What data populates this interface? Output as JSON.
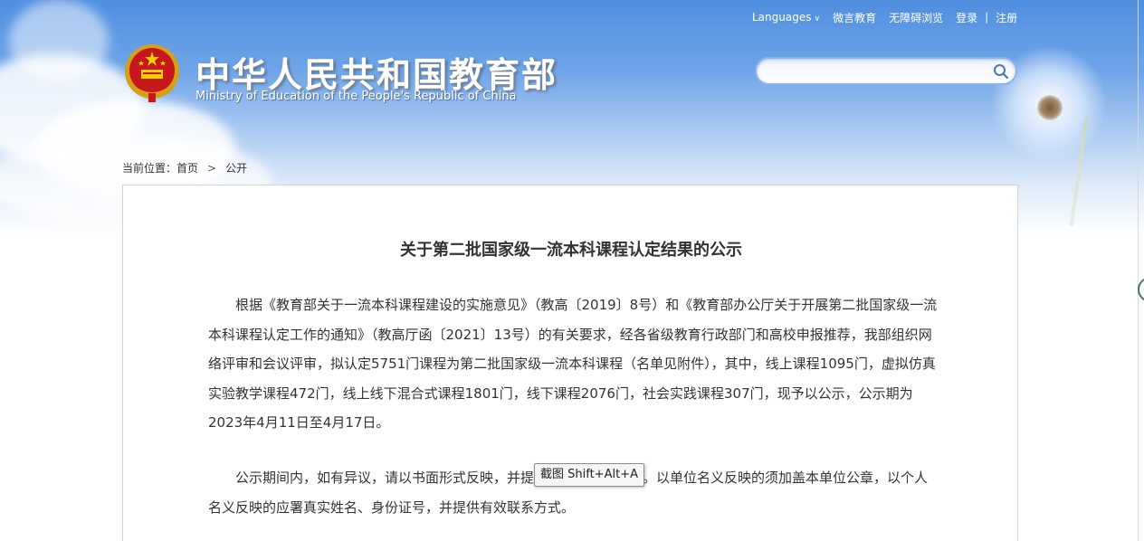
{
  "header": {
    "title_cn": "中华人民共和国教育部",
    "title_en": "Ministry of Education of the People's Republic of China",
    "links": {
      "languages": "Languages",
      "weiyan": "微言教育",
      "accessible": "无障碍浏览",
      "login": "登录",
      "separator": "|",
      "register": "注册"
    },
    "search": {
      "placeholder": "",
      "value": ""
    }
  },
  "breadcrumb": {
    "prefix": "当前位置：",
    "home": "首页",
    "separator": ">",
    "current": "公开"
  },
  "article": {
    "title": "关于第二批国家级一流本科课程认定结果的公示",
    "paragraph1": "根据《教育部关于一流本科课程建设的实施意见》（教高〔2019〕8号）和《教育部办公厅关于开展第二批国家级一流本科课程认定工作的通知》（教高厅函〔2021〕13号）的有关要求，经各省级教育行政部门和高校申报推荐，我部组织网络评审和会议评审，拟认定5751门课程为第二批国家级一流本科课程（名单见附件），其中，线上课程1095门，虚拟仿真实验教学课程472门，线上线下混合式课程1801门，线下课程2076门，社会实践课程307门，现予以公示，公示期为2023年4月11日至4月17日。",
    "paragraph2": "公示期间内，如有异议，请以书面形式反映，并提供必要的证明材料。以单位名义反映的须加盖本单位公章，以个人名义反映的应署真实姓名、身份证号，并提供有效联系方式。"
  },
  "tooltip": {
    "text": "截图 Shift+Alt+A"
  },
  "colors": {
    "sky_top": "#4f8fe0",
    "text": "#333333",
    "border": "#d3d3d3"
  },
  "icons": [
    "national-emblem-icon",
    "search-icon",
    "chevron-down-icon"
  ]
}
